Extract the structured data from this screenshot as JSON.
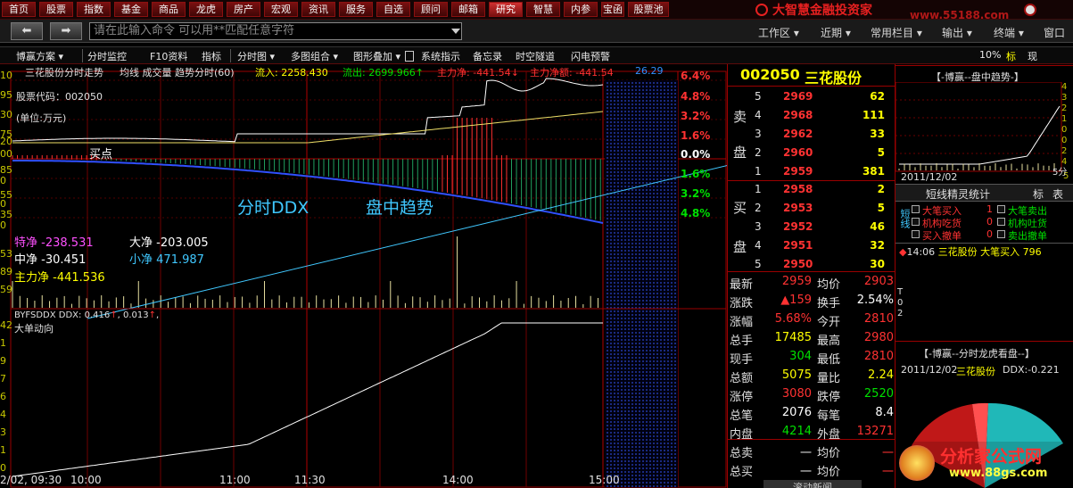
{
  "topbar": {
    "tabs": [
      "首页",
      "股票",
      "指数",
      "基金",
      "商品",
      "龙虎",
      "房产",
      "宏观",
      "资讯",
      "服务",
      "自选",
      "顾问",
      "邮箱",
      "研究",
      "智慧",
      "内参",
      "宝函",
      "股票池"
    ],
    "brand": "大智慧金融投资家",
    "watermark": "www.55188.com"
  },
  "cmdbar": {
    "placeholder": "请在此输入命令    可以用**匹配任意字符",
    "menus": [
      "工作区",
      "近期",
      "常用栏目",
      "输出",
      "终端",
      "窗口"
    ]
  },
  "toolbar": {
    "items": [
      "博赢方案",
      "分时监控",
      "F10资料",
      "指标",
      "分时图",
      "多图组合",
      "图形叠加",
      "系统指示",
      "备忘录",
      "时空隧道",
      "闪电预警"
    ],
    "zoom": "10%",
    "right_tabs": [
      "标",
      "现"
    ]
  },
  "chart_header": {
    "title": "三花股份分时走势",
    "mode": "均线 成交量 趋势分时(60)",
    "inflow_label": "流入:",
    "inflow": "2258.430",
    "outflow_label": "流出:",
    "outflow": "2699.966",
    "main_net_label": "主力净:",
    "main_net": "-441.54",
    "main_net_amt_label": "主力净额:",
    "main_net_amt": "-441.54",
    "extra": "26.29"
  },
  "overlay": {
    "stock_code": "股票代码：002050",
    "unit": "(单位:万元)",
    "buy_point": "买点",
    "ddx_label": "分时DDX",
    "trend_label": "盘中趋势",
    "flows": {
      "special_label": "特净",
      "special": "-238.531",
      "big_label": "大净",
      "big": "-203.005",
      "mid_label": "中净",
      "mid": "-30.451",
      "small_label": "小净",
      "small": "471.987",
      "main_label": "主力净",
      "main": "-441.536"
    }
  },
  "indicator": {
    "title": "BYFSDDX  DDX: 0.416",
    "v1": "0.416",
    "v2": "0.013",
    "name": "大单动向"
  },
  "axis": {
    "pct_up": [
      "6.4%",
      "4.8%",
      "3.2%",
      "1.6%"
    ],
    "zero": "0.0%",
    "pct_down": [
      "1.6%",
      "3.2%",
      "4.8%"
    ],
    "left": [
      "10",
      "95",
      "30",
      "75",
      "20",
      "00",
      "85",
      "0",
      "55",
      "0",
      "35",
      "0"
    ],
    "left_low": [
      "42",
      "1",
      "9",
      "7",
      "6",
      "4",
      "3",
      "1",
      "0"
    ],
    "left_vol": [
      "53",
      "89",
      "59"
    ],
    "times": [
      "2/02, 09:30",
      "10:00",
      "11:00",
      "11:30",
      "14:00",
      "15:00"
    ]
  },
  "quote": {
    "code": "002050",
    "name": "三花股份",
    "sell_label": [
      "卖",
      "盘"
    ],
    "buy_label": [
      "买",
      "盘"
    ],
    "sells": [
      {
        "lvl": "5",
        "price": "2969",
        "vol": "62"
      },
      {
        "lvl": "4",
        "price": "2968",
        "vol": "111"
      },
      {
        "lvl": "3",
        "price": "2962",
        "vol": "33"
      },
      {
        "lvl": "2",
        "price": "2960",
        "vol": "5"
      },
      {
        "lvl": "1",
        "price": "2959",
        "vol": "381"
      }
    ],
    "buys": [
      {
        "lvl": "1",
        "price": "2958",
        "vol": "2"
      },
      {
        "lvl": "2",
        "price": "2953",
        "vol": "5"
      },
      {
        "lvl": "3",
        "price": "2952",
        "vol": "46"
      },
      {
        "lvl": "4",
        "price": "2951",
        "vol": "32"
      },
      {
        "lvl": "5",
        "price": "2950",
        "vol": "30"
      }
    ],
    "stats": [
      [
        "最新",
        "2959",
        "均价",
        "2903"
      ],
      [
        "涨跌",
        "▲159",
        "换手",
        "2.54%"
      ],
      [
        "涨幅",
        "5.68%",
        "今开",
        "2810"
      ],
      [
        "总手",
        "17485",
        "最高",
        "2980"
      ],
      [
        "现手",
        "304",
        "最低",
        "2810"
      ],
      [
        "总额",
        "5075",
        "量比",
        "2.24"
      ],
      [
        "涨停",
        "3080",
        "跌停",
        "2520"
      ],
      [
        "总笔",
        "2076",
        "每笔",
        "8.4"
      ],
      [
        "内盘",
        "4214",
        "外盘",
        "13271"
      ],
      [
        "总卖",
        "一",
        "均价",
        "一"
      ],
      [
        "总买",
        "一",
        "均价",
        "一"
      ]
    ],
    "news": "滚动新闻"
  },
  "mini_trend": {
    "title": "【-博赢--盘中趋势-】",
    "date": "2011/12/02",
    "y": [
      "4",
      "3",
      "2",
      "1",
      "0",
      "0",
      "2",
      "4",
      "5"
    ],
    "xlabel": "5分"
  },
  "elves": {
    "title": "短线精灵统计",
    "tabs": [
      "标",
      "表"
    ],
    "side": "短线",
    "items": [
      {
        "label": "大笔买入",
        "val": "1"
      },
      {
        "label": "大笔卖出",
        "val": ""
      },
      {
        "label": "机构吃货",
        "val": "0"
      },
      {
        "label": "机构吐货",
        "val": ""
      },
      {
        "label": "买入撤单",
        "val": "0"
      },
      {
        "label": "卖出撤单",
        "val": ""
      }
    ],
    "alert_time": "14:06",
    "alert_stock": "三花股份",
    "alert_type": "大笔买入",
    "alert_vol": "796",
    "side2": [
      "T",
      "0",
      "2"
    ]
  },
  "dragon": {
    "title": "【-博赢--分时龙虎看盘--】",
    "date": "2011/12/02",
    "stock": "三花股份",
    "ddx": "DDX:-0.221",
    "watermark": "分析家公式网",
    "watermark_url": "www.88gs.com"
  },
  "colors": {
    "up": "#ff3232",
    "down": "#00e600",
    "yellow": "#ffff00",
    "cyan": "#00e0e0",
    "bg": "#000000",
    "grid": "#9a0000"
  }
}
